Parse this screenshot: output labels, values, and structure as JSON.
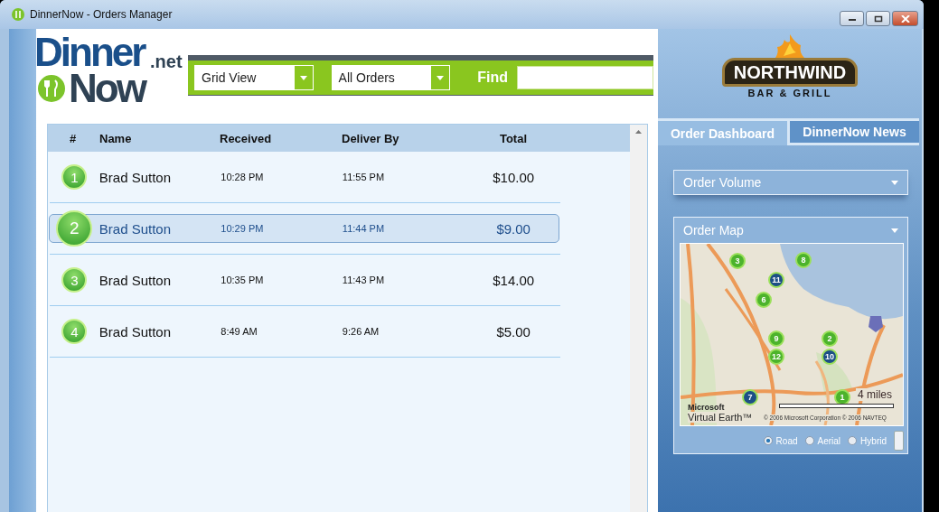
{
  "window": {
    "title": "DinnerNow - Orders Manager"
  },
  "logo": {
    "word_1": "Dinner",
    "word_2": "Now",
    "suffix": ".net"
  },
  "toolbar": {
    "view": "Grid View",
    "filter": "All Orders",
    "find_label": "Find"
  },
  "orders": {
    "columns": [
      "#",
      "Name",
      "Received",
      "Deliver By",
      "Total"
    ],
    "rows": [
      {
        "number": "1",
        "name": "Brad Sutton",
        "received": "10:28 PM",
        "deliver_by": "11:55 PM",
        "total": "$10.00",
        "selected": false
      },
      {
        "number": "2",
        "name": "Brad Sutton",
        "received": "10:29 PM",
        "deliver_by": "11:44 PM",
        "total": "$9.00",
        "selected": true
      },
      {
        "number": "3",
        "name": "Brad Sutton",
        "received": "10:35 PM",
        "deliver_by": "11:43 PM",
        "total": "$14.00",
        "selected": false
      },
      {
        "number": "4",
        "name": "Brad Sutton",
        "received": "8:49 AM",
        "deliver_by": "9:26 AM",
        "total": "$5.00",
        "selected": false
      }
    ]
  },
  "brand": {
    "name": "NORTHWIND",
    "tagline": "BAR & GRILL"
  },
  "tabs": [
    {
      "label": "Order Dashboard",
      "selected": true
    },
    {
      "label": "DinnerNow News",
      "selected": false
    }
  ],
  "order_volume": {
    "title": "Order Volume"
  },
  "order_map": {
    "title": "Order Map",
    "pins": [
      {
        "label": "3",
        "color": "#4cb32c"
      },
      {
        "label": "8",
        "color": "#4cb32c"
      },
      {
        "label": "11",
        "color": "#1d4f86"
      },
      {
        "label": "6",
        "color": "#4cb32c"
      },
      {
        "label": "9",
        "color": "#4cb32c"
      },
      {
        "label": "12",
        "color": "#4cb32c"
      },
      {
        "label": "2",
        "color": "#4cb32c"
      },
      {
        "label": "10",
        "color": "#1d4f86"
      },
      {
        "label": "7",
        "color": "#1d4f86"
      },
      {
        "label": "1",
        "color": "#4cb32c"
      }
    ],
    "scale": "4 miles",
    "logo_1": "Microsoft",
    "logo_2": "Virtual Earth™",
    "copyright": "© 2006 Microsoft Corporation © 2006 NAVTEQ",
    "view_options": [
      {
        "label": "Road",
        "selected": true
      },
      {
        "label": "Aerial",
        "selected": false
      },
      {
        "label": "Hybrid",
        "selected": false
      }
    ]
  }
}
